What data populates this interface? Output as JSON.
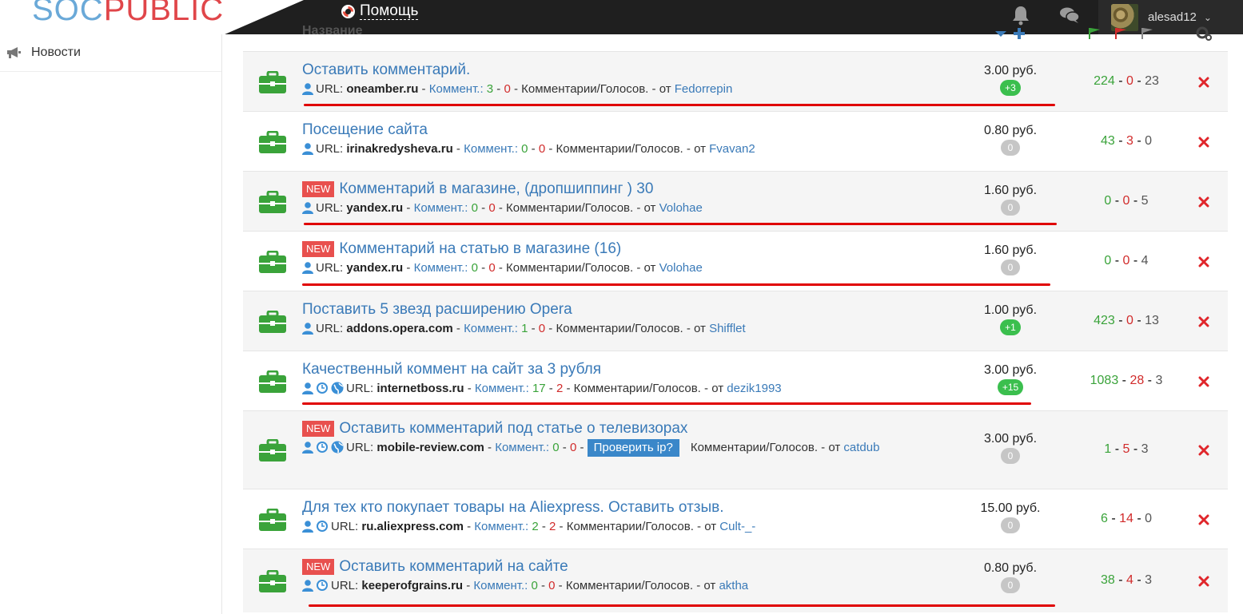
{
  "header": {
    "logo_soc": "SOC",
    "logo_public": "PUBLIC",
    "help_label": "Помощь",
    "username": "alesad12"
  },
  "sidebar": {
    "items": [
      {
        "label": "Новости",
        "icon": "megaphone-icon"
      }
    ]
  },
  "table_header": {
    "name_label": "Название"
  },
  "colors": {
    "accent": "#3a7ab8",
    "green": "#3aa33a",
    "red": "#d12b2b",
    "new_badge": "#e8504e"
  },
  "tasks": [
    {
      "new": false,
      "title": "Оставить комментарий.",
      "icons": [
        "user"
      ],
      "url_label": "URL:",
      "url": "oneamber.ru",
      "comm_label": "Коммент.:",
      "c_green": "3",
      "c_red": "0",
      "type": "Комментарии/Голосов.",
      "from_label": "от",
      "author": "Fedorrepin",
      "price": "3.00",
      "currency": "руб.",
      "pill": "+3",
      "pill_active": true,
      "s_green": "224",
      "s_red": "0",
      "s_grey": "23",
      "check_label": ""
    },
    {
      "new": false,
      "title": "Посещение сайта",
      "icons": [
        "user"
      ],
      "url_label": "URL:",
      "url": "irinakredysheva.ru",
      "comm_label": "Коммент.:",
      "c_green": "0",
      "c_red": "0",
      "type": "Комментарии/Голосов.",
      "from_label": "от",
      "author": "Fvavan2",
      "price": "0.80",
      "currency": "руб.",
      "pill": "0",
      "pill_active": false,
      "s_green": "43",
      "s_red": "3",
      "s_grey": "0",
      "check_label": ""
    },
    {
      "new": true,
      "title": "Комментарий в магазине, (дропшиппинг ) 30",
      "icons": [
        "user"
      ],
      "url_label": "URL:",
      "url": "yandex.ru",
      "comm_label": "Коммент.:",
      "c_green": "0",
      "c_red": "0",
      "type": "Комментарии/Голосов.",
      "from_label": "от",
      "author": "Volohae",
      "price": "1.60",
      "currency": "руб.",
      "pill": "0",
      "pill_active": false,
      "s_green": "0",
      "s_red": "0",
      "s_grey": "5",
      "check_label": ""
    },
    {
      "new": true,
      "title": "Комментарий на статью в магазине (16)",
      "icons": [
        "user"
      ],
      "url_label": "URL:",
      "url": "yandex.ru",
      "comm_label": "Коммент.:",
      "c_green": "0",
      "c_red": "0",
      "type": "Комментарии/Голосов.",
      "from_label": "от",
      "author": "Volohae",
      "price": "1.60",
      "currency": "руб.",
      "pill": "0",
      "pill_active": false,
      "s_green": "0",
      "s_red": "0",
      "s_grey": "4",
      "check_label": ""
    },
    {
      "new": false,
      "title": "Поставить 5 звезд расширению Opera",
      "icons": [
        "user"
      ],
      "url_label": "URL:",
      "url": "addons.opera.com",
      "comm_label": "Коммент.:",
      "c_green": "1",
      "c_red": "0",
      "type": "Комментарии/Голосов.",
      "from_label": "от",
      "author": "Shifflet",
      "price": "1.00",
      "currency": "руб.",
      "pill": "+1",
      "pill_active": true,
      "s_green": "423",
      "s_red": "0",
      "s_grey": "13",
      "check_label": ""
    },
    {
      "new": false,
      "title": "Качественный коммент на сайт за 3 рубля",
      "icons": [
        "user",
        "clock",
        "globe"
      ],
      "url_label": "URL:",
      "url": "internetboss.ru",
      "comm_label": "Коммент.:",
      "c_green": "17",
      "c_red": "2",
      "type": "Комментарии/Голосов.",
      "from_label": "от",
      "author": "dezik1993",
      "price": "3.00",
      "currency": "руб.",
      "pill": "+15",
      "pill_active": true,
      "s_green": "1083",
      "s_red": "28",
      "s_grey": "3",
      "check_label": ""
    },
    {
      "new": true,
      "title": "Оставить комментарий под статье о телевизорах",
      "icons": [
        "user",
        "clock",
        "globe"
      ],
      "url_label": "URL:",
      "url": "mobile-review.com",
      "comm_label": "Коммент.:",
      "c_green": "0",
      "c_red": "0",
      "type": "Комментарии/Голосов.",
      "from_label": "от",
      "author": "catdub",
      "price": "3.00",
      "currency": "руб.",
      "pill": "0",
      "pill_active": false,
      "s_green": "1",
      "s_red": "5",
      "s_grey": "3",
      "check_label": "Проверить ip?"
    },
    {
      "new": false,
      "title": "Для тех кто покупает товары на Aliexpress. Оставить отзыв.",
      "icons": [
        "user",
        "clock"
      ],
      "url_label": "URL:",
      "url": "ru.aliexpress.com",
      "comm_label": "Коммент.:",
      "c_green": "2",
      "c_red": "2",
      "type": "Комментарии/Голосов.",
      "from_label": "от",
      "author": "Cult-_-",
      "price": "15.00",
      "currency": "руб.",
      "pill": "0",
      "pill_active": false,
      "s_green": "6",
      "s_red": "14",
      "s_grey": "0",
      "check_label": ""
    },
    {
      "new": true,
      "title": "Оставить комментарий на сайте",
      "icons": [
        "user",
        "clock"
      ],
      "url_label": "URL:",
      "url": "keeperofgrains.ru",
      "comm_label": "Коммент.:",
      "c_green": "0",
      "c_red": "0",
      "type": "Комментарии/Голосов.",
      "from_label": "от",
      "author": "aktha",
      "price": "0.80",
      "currency": "руб.",
      "pill": "0",
      "pill_active": false,
      "s_green": "38",
      "s_red": "4",
      "s_grey": "3",
      "check_label": ""
    }
  ],
  "new_label": "NEW"
}
